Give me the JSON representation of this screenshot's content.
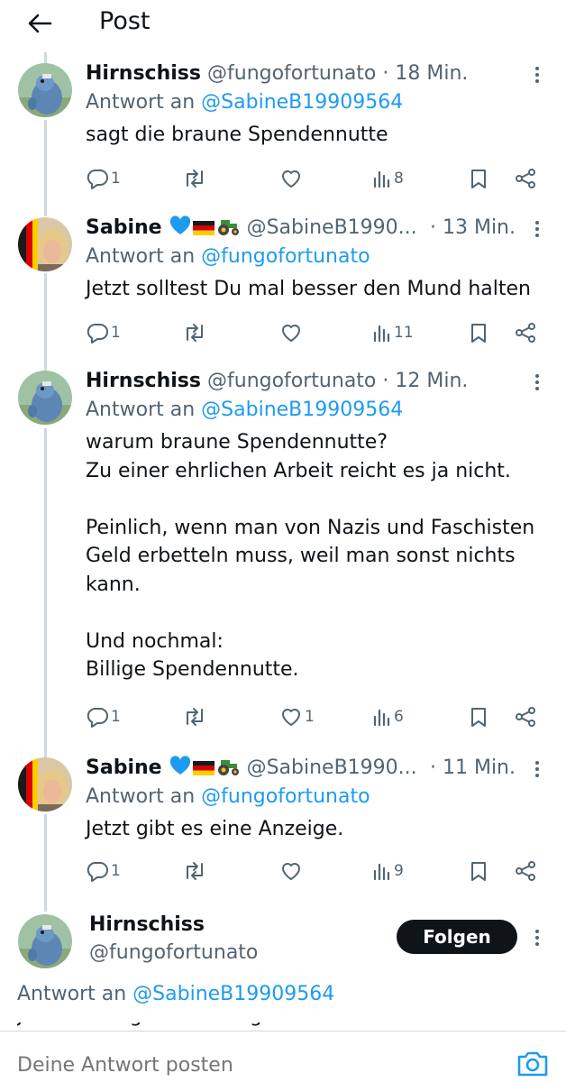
{
  "header": {
    "title": "Post"
  },
  "tweets": [
    {
      "name": "Hirnschiss",
      "handle": "@fungofortunato",
      "time": "18 Min.",
      "reply_prefix": "Antwort an",
      "reply_to": "@SabineB19909564",
      "text": "sagt die braune Spendennutte",
      "replies": "1",
      "reposts": "",
      "likes": "",
      "views": "8"
    },
    {
      "name": "Sabine",
      "handle": "@SabineB1990...",
      "time": "13 Min.",
      "reply_prefix": "Antwort an",
      "reply_to": "@fungofortunato",
      "text": "Jetzt solltest Du mal besser den Mund halten",
      "replies": "1",
      "reposts": "",
      "likes": "",
      "views": "11"
    },
    {
      "name": "Hirnschiss",
      "handle": "@fungofortunato",
      "time": "12 Min.",
      "reply_prefix": "Antwort an",
      "reply_to": "@SabineB19909564",
      "text": "warum braune Spendennutte?\nZu einer ehrlichen Arbeit reicht es ja nicht.\n\nPeinlich, wenn man von Nazis und Faschisten\nGeld erbetteln muss, weil man sonst nichts\nkann.\n\nUnd nochmal:\nBillige Spendennutte.",
      "replies": "1",
      "reposts": "",
      "likes": "1",
      "views": "6"
    },
    {
      "name": "Sabine",
      "handle": "@SabineB1990...",
      "time": "11 Min.",
      "reply_prefix": "Antwort an",
      "reply_to": "@fungofortunato",
      "text": "Jetzt gibt es eine Anzeige.",
      "replies": "1",
      "reposts": "",
      "likes": "",
      "views": "9"
    }
  ],
  "focus_post": {
    "name": "Hirnschiss",
    "handle": "@fungofortunato",
    "follow_label": "Folgen",
    "reply_prefix": "Antwort an",
    "reply_to": "@SabineB19909564",
    "text_partial": "Jetzt bekriegt der Anzeigeblei..."
  },
  "composer": {
    "placeholder": "Deine Antwort posten"
  },
  "icons": {
    "back": "arrow-left-icon",
    "more": "more-vertical-icon",
    "reply": "reply-icon",
    "repost": "repost-icon",
    "like": "heart-icon",
    "views": "analytics-icon",
    "bookmark": "bookmark-icon",
    "share": "share-icon",
    "camera": "camera-icon",
    "sabine_emojis": [
      "blue-heart-icon",
      "german-flag-icon",
      "tractor-icon"
    ]
  },
  "colors": {
    "accent": "#1d9bf0",
    "text": "#0f1419",
    "secondary": "#536471",
    "thread_line": "#cfd9de"
  }
}
